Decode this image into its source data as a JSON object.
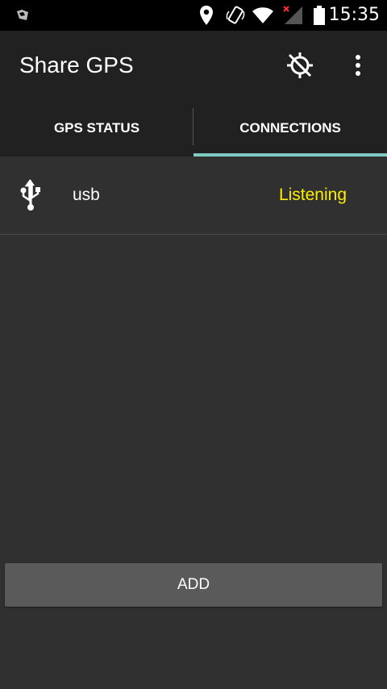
{
  "status_bar": {
    "time": "15:35",
    "icons": [
      "notification-icon",
      "location-icon",
      "rotate-icon",
      "wifi-icon",
      "signal-no-service-icon",
      "battery-icon"
    ]
  },
  "app_bar": {
    "title": "Share GPS",
    "actions": [
      "gps-off-icon",
      "overflow-menu-icon"
    ]
  },
  "tabs": [
    {
      "label": "GPS STATUS",
      "selected": false
    },
    {
      "label": "CONNECTIONS",
      "selected": true
    }
  ],
  "connections": [
    {
      "icon": "usb-icon",
      "name": "usb",
      "status": "Listening"
    }
  ],
  "add_button": {
    "label": "ADD"
  },
  "colors": {
    "background": "#303030",
    "bar": "#212121",
    "tab_indicator": "#80cbc4",
    "status_listening": "#ffee00",
    "button": "#5a5a5a"
  }
}
